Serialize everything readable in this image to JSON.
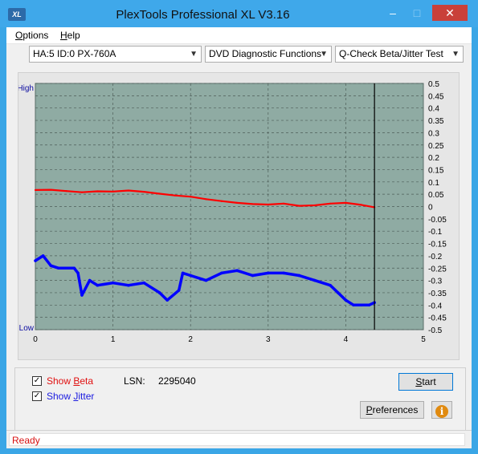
{
  "window": {
    "title": "PlexTools Professional XL V3.16",
    "icon_text": "XL",
    "min_icon": "–",
    "max_icon": "□",
    "close_icon": "✕"
  },
  "menu": {
    "options_first": "O",
    "options_rest": "ptions",
    "help_first": "H",
    "help_rest": "elp"
  },
  "toolbar": {
    "device": "HA:5 ID:0  PX-760A",
    "function": "DVD Diagnostic Functions",
    "test": "Q-Check Beta/Jitter Test"
  },
  "chart_data": {
    "type": "line",
    "high_label": "High",
    "low_label": "Low",
    "x_ticks": [
      "0",
      "1",
      "2",
      "3",
      "4",
      "5"
    ],
    "y_ticks": [
      "0.5",
      "0.45",
      "0.4",
      "0.35",
      "0.3",
      "0.25",
      "0.2",
      "0.15",
      "0.1",
      "0.05",
      "0",
      "-0.05",
      "-0.1",
      "-0.15",
      "-0.2",
      "-0.25",
      "-0.3",
      "-0.35",
      "-0.4",
      "-0.45",
      "-0.5"
    ],
    "xlim": [
      0,
      5
    ],
    "ylim": [
      -0.5,
      0.5
    ],
    "end_marker_x": 4.37,
    "grid": true,
    "colors": {
      "plot_bg": "#8faba3",
      "beta": "#ff0000",
      "jitter": "#0000ff",
      "high_low": "#0a0aa0"
    },
    "series": [
      {
        "key": "beta",
        "x": [
          0,
          0.2,
          0.4,
          0.6,
          0.8,
          1.0,
          1.2,
          1.4,
          1.6,
          1.8,
          2.0,
          2.2,
          2.4,
          2.6,
          2.8,
          3.0,
          3.2,
          3.4,
          3.6,
          3.8,
          4.0,
          4.2,
          4.37
        ],
        "y": [
          0.067,
          0.068,
          0.063,
          0.058,
          0.062,
          0.061,
          0.065,
          0.06,
          0.052,
          0.045,
          0.04,
          0.03,
          0.022,
          0.015,
          0.01,
          0.008,
          0.012,
          0.003,
          0.005,
          0.012,
          0.015,
          0.007,
          -0.003
        ]
      },
      {
        "key": "jitter",
        "x": [
          0,
          0.1,
          0.2,
          0.3,
          0.4,
          0.5,
          0.55,
          0.6,
          0.7,
          0.8,
          1.0,
          1.2,
          1.4,
          1.6,
          1.7,
          1.85,
          1.9,
          2.0,
          2.2,
          2.4,
          2.6,
          2.8,
          3.0,
          3.2,
          3.4,
          3.6,
          3.8,
          3.9,
          4.0,
          4.1,
          4.2,
          4.3,
          4.37
        ],
        "y": [
          -0.22,
          -0.2,
          -0.24,
          -0.25,
          -0.25,
          -0.25,
          -0.27,
          -0.36,
          -0.3,
          -0.32,
          -0.31,
          -0.32,
          -0.31,
          -0.35,
          -0.38,
          -0.34,
          -0.27,
          -0.28,
          -0.3,
          -0.27,
          -0.26,
          -0.28,
          -0.27,
          -0.27,
          -0.28,
          -0.3,
          -0.32,
          -0.35,
          -0.38,
          -0.4,
          -0.4,
          -0.4,
          -0.39
        ]
      }
    ]
  },
  "controls": {
    "show_beta_first": "Show ",
    "show_beta_u": "B",
    "show_beta_rest": "eta",
    "show_jitter_first": "Show ",
    "show_jitter_u": "J",
    "show_jitter_rest": "itter",
    "beta_checked": "✓",
    "jitter_checked": "✓",
    "lsn_label": "LSN:",
    "lsn_value": "2295040",
    "start_u": "S",
    "start_rest": "tart",
    "prefs_u": "P",
    "prefs_rest": "references",
    "info_icon": "i"
  },
  "status": {
    "text": "Ready"
  }
}
